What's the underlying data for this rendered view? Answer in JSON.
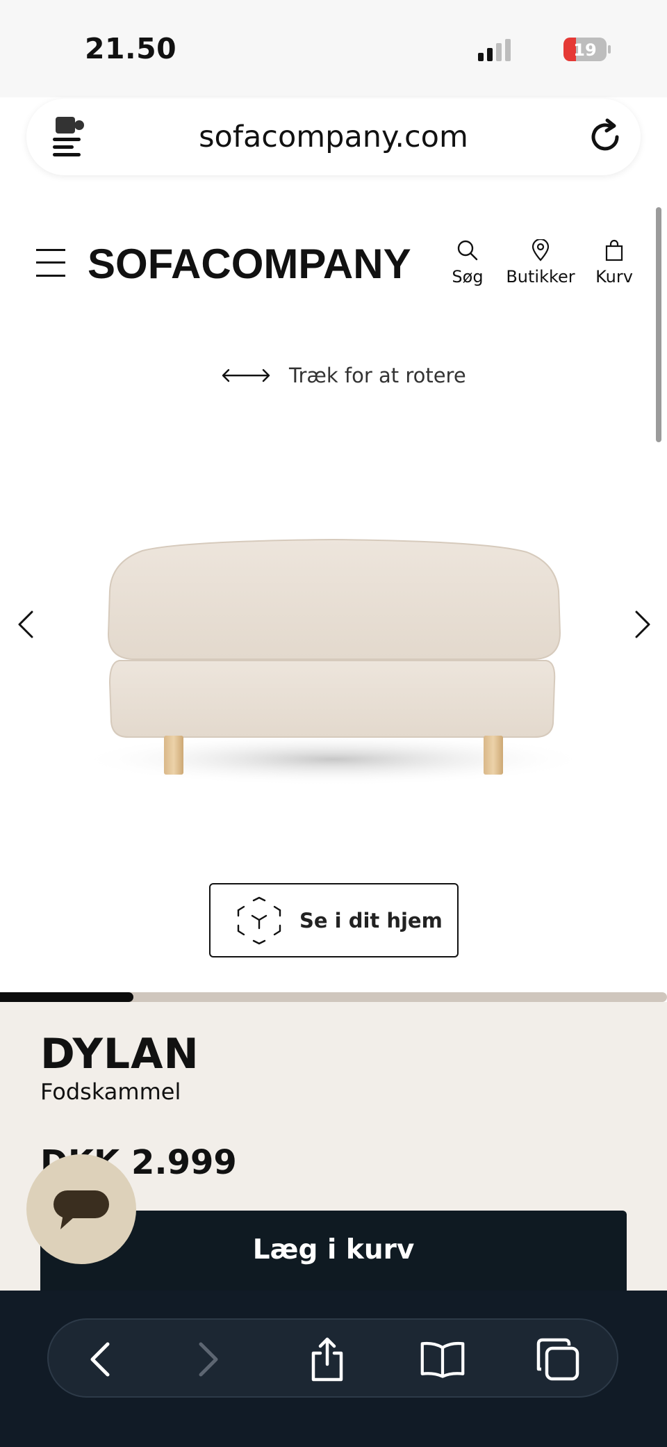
{
  "status_bar": {
    "time": "21.50",
    "battery_level": "19"
  },
  "browser": {
    "url": "sofacompany.com"
  },
  "header": {
    "logo": "SOFACOMPANY",
    "search_label": "Søg",
    "stores_label": "Butikker",
    "cart_label": "Kurv"
  },
  "viewer": {
    "rotate_hint": "Træk for at rotere",
    "ar_button_label": "Se i dit hjem",
    "carousel_progress": 0.2
  },
  "product": {
    "name": "DYLAN",
    "type": "Fodskammel",
    "price": "DKK 2.999",
    "add_to_cart_label": "Læg i kurv"
  },
  "colors": {
    "panel_bg": "#f2eee9",
    "cart_button_bg": "#0f1a22",
    "chat_bubble_bg": "#ddd1ba",
    "toolbar_bg": "#111b26"
  },
  "icons": [
    "extension-icon",
    "reload-icon",
    "menu-icon",
    "search-icon",
    "location-pin-icon",
    "shopping-bag-icon",
    "rotate-arrows-icon",
    "chevron-left-icon",
    "chevron-right-icon",
    "ar-cube-icon",
    "chat-icon",
    "back-icon",
    "forward-icon",
    "share-icon",
    "bookmarks-icon",
    "tabs-icon"
  ]
}
